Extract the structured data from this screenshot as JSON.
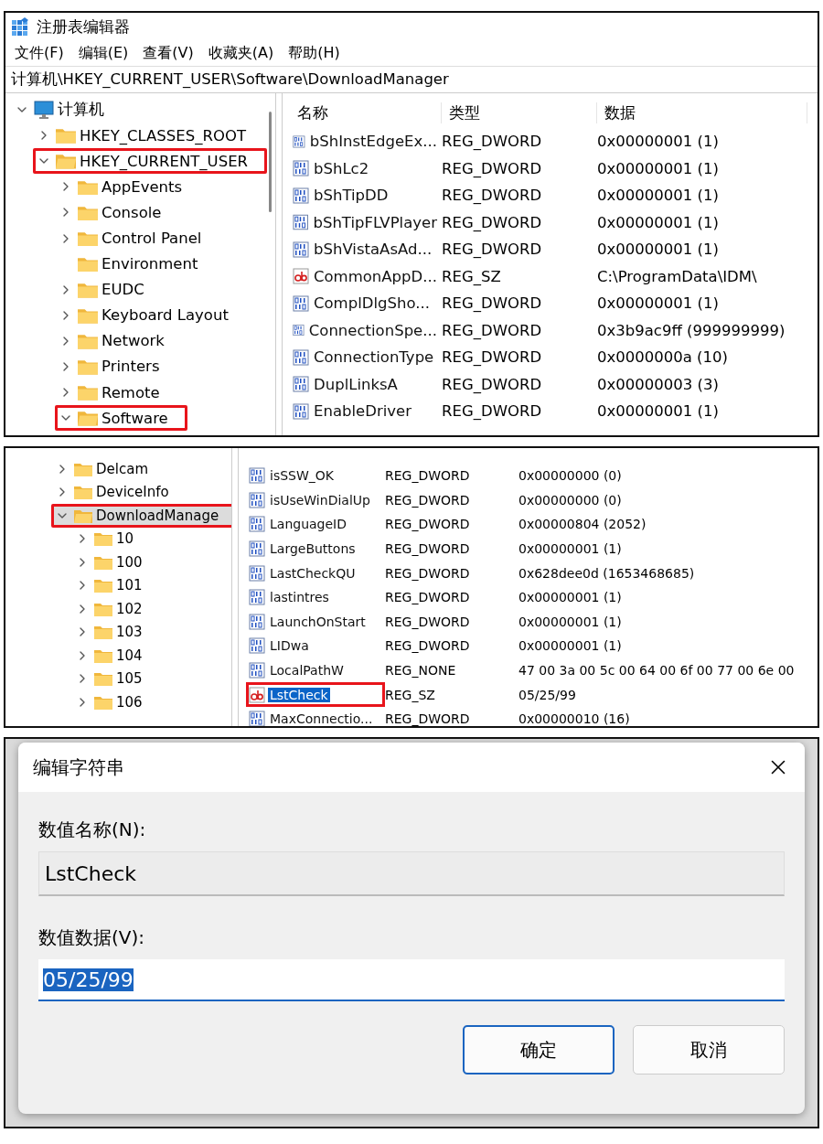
{
  "registry_editor": {
    "title": "注册表编辑器",
    "menu": [
      "文件(F)",
      "编辑(E)",
      "查看(V)",
      "收藏夹(A)",
      "帮助(H)"
    ],
    "address": "计算机\\HKEY_CURRENT_USER\\Software\\DownloadManager",
    "tree": [
      {
        "label": "计算机",
        "kind": "computer",
        "expanded": true,
        "selected": false,
        "highlighted": false,
        "children": [
          {
            "label": "HKEY_CLASSES_ROOT",
            "kind": "folder",
            "expanded": false,
            "selected": false,
            "highlighted": false
          },
          {
            "label": "HKEY_CURRENT_USER",
            "kind": "folder",
            "expanded": true,
            "selected": false,
            "highlighted": true,
            "children": [
              {
                "label": "AppEvents",
                "kind": "folder",
                "expanded": false,
                "selected": false,
                "highlighted": false
              },
              {
                "label": "Console",
                "kind": "folder",
                "expanded": false,
                "selected": false,
                "highlighted": false
              },
              {
                "label": "Control Panel",
                "kind": "folder",
                "expanded": false,
                "selected": false,
                "highlighted": false
              },
              {
                "label": "Environment",
                "kind": "empty_folder",
                "expanded": false,
                "selected": false,
                "highlighted": false
              },
              {
                "label": "EUDC",
                "kind": "folder",
                "expanded": false,
                "selected": false,
                "highlighted": false
              },
              {
                "label": "Keyboard Layout",
                "kind": "folder",
                "expanded": false,
                "selected": false,
                "highlighted": false
              },
              {
                "label": "Network",
                "kind": "folder",
                "expanded": false,
                "selected": false,
                "highlighted": false
              },
              {
                "label": "Printers",
                "kind": "folder",
                "expanded": false,
                "selected": false,
                "highlighted": false
              },
              {
                "label": "Remote",
                "kind": "folder",
                "expanded": false,
                "selected": false,
                "highlighted": false
              },
              {
                "label": "Software",
                "kind": "folder",
                "expanded": true,
                "selected": false,
                "highlighted": true
              }
            ]
          }
        ]
      }
    ],
    "columns": [
      "名称",
      "类型",
      "数据"
    ],
    "rows": [
      {
        "name": "bShInstEdgeEx...",
        "type": "REG_DWORD",
        "data": "0x00000001 (1)",
        "kind": "binary",
        "selected": false,
        "highlighted": false
      },
      {
        "name": "bShLc2",
        "type": "REG_DWORD",
        "data": "0x00000001 (1)",
        "kind": "binary",
        "selected": false,
        "highlighted": false
      },
      {
        "name": "bShTipDD",
        "type": "REG_DWORD",
        "data": "0x00000001 (1)",
        "kind": "binary",
        "selected": false,
        "highlighted": false
      },
      {
        "name": "bShTipFLVPlayer",
        "type": "REG_DWORD",
        "data": "0x00000001 (1)",
        "kind": "binary",
        "selected": false,
        "highlighted": false
      },
      {
        "name": "bShVistaAsAd...",
        "type": "REG_DWORD",
        "data": "0x00000001 (1)",
        "kind": "binary",
        "selected": false,
        "highlighted": false
      },
      {
        "name": "CommonAppD...",
        "type": "REG_SZ",
        "data": "C:\\ProgramData\\IDM\\",
        "kind": "string",
        "selected": false,
        "highlighted": false
      },
      {
        "name": "ComplDlgSho...",
        "type": "REG_DWORD",
        "data": "0x00000001 (1)",
        "kind": "binary",
        "selected": false,
        "highlighted": false
      },
      {
        "name": "ConnectionSpe...",
        "type": "REG_DWORD",
        "data": "0x3b9ac9ff (999999999)",
        "kind": "binary",
        "selected": false,
        "highlighted": false
      },
      {
        "name": "ConnectionType",
        "type": "REG_DWORD",
        "data": "0x0000000a (10)",
        "kind": "binary",
        "selected": false,
        "highlighted": false
      },
      {
        "name": "DuplLinksA",
        "type": "REG_DWORD",
        "data": "0x00000003 (3)",
        "kind": "binary",
        "selected": false,
        "highlighted": false
      },
      {
        "name": "EnableDriver",
        "type": "REG_DWORD",
        "data": "0x00000001 (1)",
        "kind": "binary",
        "selected": false,
        "highlighted": false
      }
    ]
  },
  "registry_detail": {
    "tree": [
      {
        "label": "Delcam",
        "kind": "folder",
        "expanded": false,
        "selected": false,
        "highlighted": false
      },
      {
        "label": "DeviceInfo",
        "kind": "folder",
        "expanded": false,
        "selected": false,
        "highlighted": false
      },
      {
        "label": "DownloadManage",
        "kind": "folder",
        "expanded": true,
        "selected": true,
        "highlighted": true,
        "children": [
          {
            "label": "10",
            "kind": "folder",
            "expanded": false,
            "selected": false,
            "highlighted": false
          },
          {
            "label": "100",
            "kind": "folder",
            "expanded": false,
            "selected": false,
            "highlighted": false
          },
          {
            "label": "101",
            "kind": "folder",
            "expanded": false,
            "selected": false,
            "highlighted": false
          },
          {
            "label": "102",
            "kind": "folder",
            "expanded": false,
            "selected": false,
            "highlighted": false
          },
          {
            "label": "103",
            "kind": "folder",
            "expanded": false,
            "selected": false,
            "highlighted": false
          },
          {
            "label": "104",
            "kind": "folder",
            "expanded": false,
            "selected": false,
            "highlighted": false
          },
          {
            "label": "105",
            "kind": "folder",
            "expanded": false,
            "selected": false,
            "highlighted": false
          },
          {
            "label": "106",
            "kind": "folder",
            "expanded": false,
            "selected": false,
            "highlighted": false
          }
        ]
      }
    ],
    "rows": [
      {
        "name": "isSSW_OK",
        "type": "REG_DWORD",
        "data": "0x00000000 (0)",
        "kind": "binary",
        "selected": false,
        "highlighted": false
      },
      {
        "name": "isUseWinDialUp",
        "type": "REG_DWORD",
        "data": "0x00000000 (0)",
        "kind": "binary",
        "selected": false,
        "highlighted": false
      },
      {
        "name": "LanguageID",
        "type": "REG_DWORD",
        "data": "0x00000804 (2052)",
        "kind": "binary",
        "selected": false,
        "highlighted": false
      },
      {
        "name": "LargeButtons",
        "type": "REG_DWORD",
        "data": "0x00000001 (1)",
        "kind": "binary",
        "selected": false,
        "highlighted": false
      },
      {
        "name": "LastCheckQU",
        "type": "REG_DWORD",
        "data": "0x628dee0d (1653468685)",
        "kind": "binary",
        "selected": false,
        "highlighted": false
      },
      {
        "name": "lastintres",
        "type": "REG_DWORD",
        "data": "0x00000001 (1)",
        "kind": "binary",
        "selected": false,
        "highlighted": false
      },
      {
        "name": "LaunchOnStart",
        "type": "REG_DWORD",
        "data": "0x00000001 (1)",
        "kind": "binary",
        "selected": false,
        "highlighted": false
      },
      {
        "name": "LIDwa",
        "type": "REG_DWORD",
        "data": "0x00000001 (1)",
        "kind": "binary",
        "selected": false,
        "highlighted": false
      },
      {
        "name": "LocalPathW",
        "type": "REG_NONE",
        "data": "47 00 3a 00 5c 00 64 00 6f 00 77 00 6e 00",
        "kind": "binary",
        "selected": false,
        "highlighted": false
      },
      {
        "name": "LstCheck",
        "type": "REG_SZ",
        "data": "05/25/99",
        "kind": "string",
        "selected": true,
        "highlighted": true
      },
      {
        "name": "MaxConnectio...",
        "type": "REG_DWORD",
        "data": "0x00000010 (16)",
        "kind": "binary",
        "selected": false,
        "highlighted": false
      }
    ]
  },
  "edit_dialog": {
    "title": "编辑字符串",
    "name_label": "数值名称(N):",
    "name_value": "LstCheck",
    "data_label": "数值数据(V):",
    "data_value": "05/25/99",
    "buttons": [
      {
        "label": "确定",
        "default": true
      },
      {
        "label": "取消",
        "default": false
      }
    ]
  }
}
